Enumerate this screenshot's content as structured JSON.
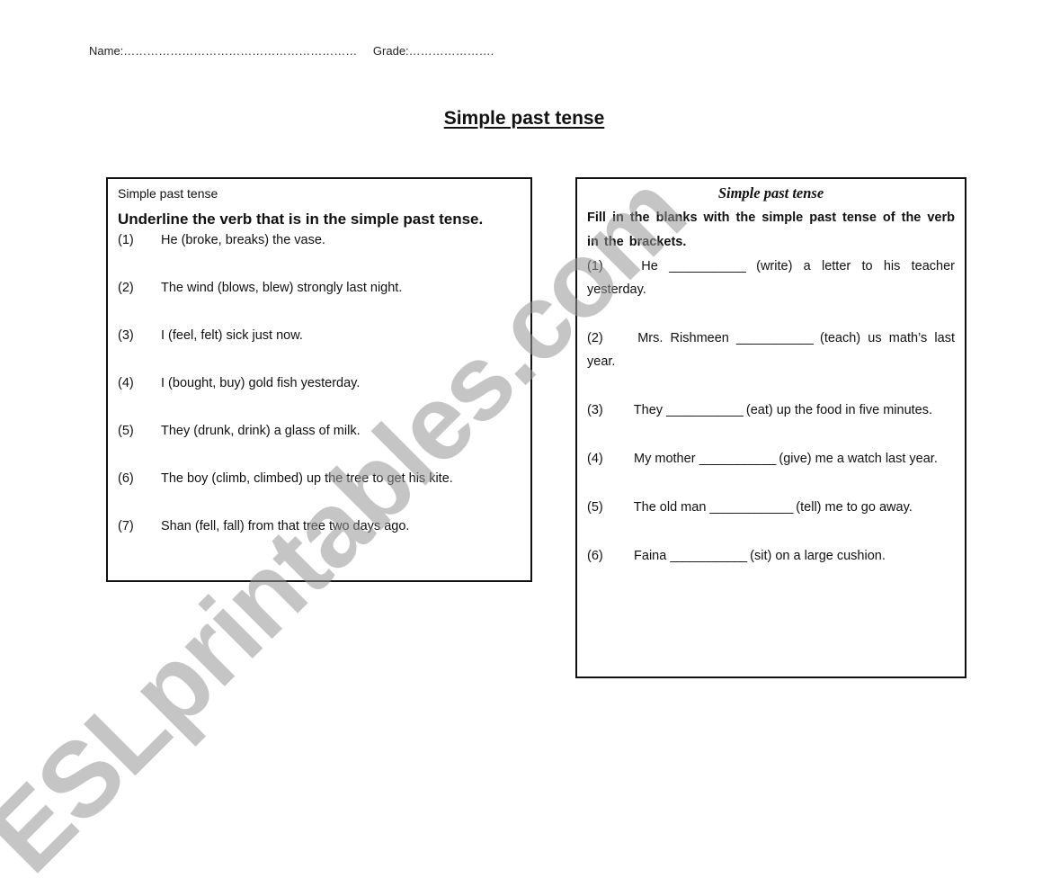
{
  "header": {
    "name_label": "Name:……………………………………………………",
    "grade_label": "Grade:…………………."
  },
  "title": "Simple past tense",
  "left_box": {
    "subtitle": "Simple past tense",
    "instruction": "Underline the verb that is in the simple past tense.",
    "items": [
      {
        "num": "(1)",
        "text": "He (broke, breaks) the vase."
      },
      {
        "num": "(2)",
        "text": "The wind (blows, blew) strongly last night."
      },
      {
        "num": "(3)",
        "text": "I (feel, felt) sick just now."
      },
      {
        "num": "(4)",
        "text": "I (bought, buy) gold fish yesterday."
      },
      {
        "num": "(5)",
        "text": "They (drunk, drink) a glass of milk."
      },
      {
        "num": "(6)",
        "text": "The boy (climb, climbed) up the tree to get his kite."
      },
      {
        "num": "(7)",
        "text": "Shan (fell, fall) from that tree two days ago."
      }
    ]
  },
  "right_box": {
    "title": "Simple past tense",
    "instruction": "Fill in the blanks with the simple past tense of the verb in the brackets.",
    "items": [
      {
        "num": "(1)",
        "before": "He",
        "blank": "____________",
        "after": "(write) a letter to his teacher yesterday."
      },
      {
        "num": "(2)",
        "before": "Mrs. Rishmeen",
        "blank": "____________",
        "after": "(teach) us math’s last year."
      },
      {
        "num": "(3)",
        "before": "They",
        "blank": "____________",
        "after": "(eat) up the food in five minutes."
      },
      {
        "num": "(4)",
        "before": "My mother",
        "blank": "____________",
        "after": "(give) me a watch last year."
      },
      {
        "num": "(5)",
        "before": "The old man",
        "blank": "_____________",
        "after": "(tell) me to go away."
      },
      {
        "num": "(6)",
        "before": "Faina",
        "blank": "____________",
        "after": "(sit) on a large cushion."
      }
    ]
  },
  "watermark": "ESLprintables.com"
}
